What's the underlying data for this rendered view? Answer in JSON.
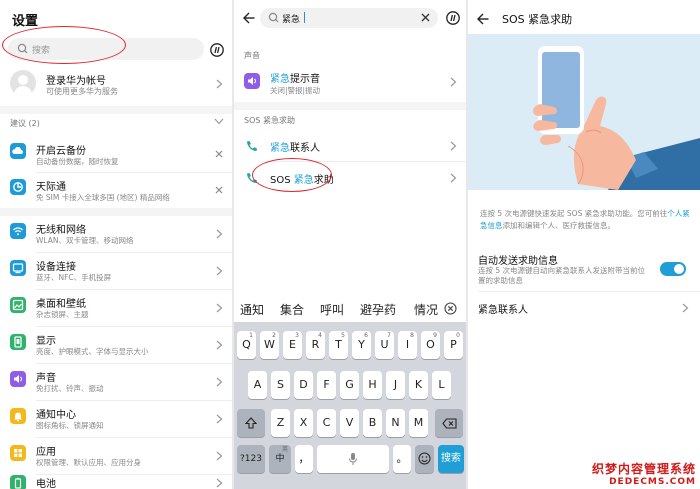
{
  "settings": {
    "title": "设置",
    "search_placeholder": "搜索",
    "account": {
      "title": "登录华为帐号",
      "subtitle": "可使用更多华为服务"
    },
    "suggestions_header": "建议 (2)",
    "suggestions": [
      {
        "title": "开启云备份",
        "subtitle": "自动备份数据，随时恢复",
        "icon": "cloud-backup-icon"
      },
      {
        "title": "天际通",
        "subtitle": "免 SIM 卡接入全球多国 (地区) 精品网络",
        "icon": "skytone-icon"
      }
    ],
    "items": [
      {
        "title": "无线和网络",
        "subtitle": "WLAN、双卡管理、移动网络",
        "icon": "wifi-icon"
      },
      {
        "title": "设备连接",
        "subtitle": "蓝牙、NFC、手机投屏",
        "icon": "device-connect-icon"
      },
      {
        "title": "桌面和壁纸",
        "subtitle": "杂志锁屏、主题",
        "icon": "wallpaper-icon"
      },
      {
        "title": "显示",
        "subtitle": "亮度、护眼模式、字体与显示大小",
        "icon": "display-icon"
      },
      {
        "title": "声音",
        "subtitle": "免打扰、铃声、振动",
        "icon": "sound-icon"
      },
      {
        "title": "通知中心",
        "subtitle": "图标角标、锁屏通知",
        "icon": "notification-icon"
      },
      {
        "title": "应用",
        "subtitle": "权限管理、默认应用、应用分身",
        "icon": "apps-icon"
      },
      {
        "title": "电池",
        "subtitle": "",
        "icon": "battery-icon"
      }
    ]
  },
  "search": {
    "query": "紧急",
    "section_sound": "声音",
    "result_sound": {
      "hl": "紧急",
      "rest": "提示音",
      "subtitle": "关闭|警报|振动"
    },
    "section_sos": "SOS 紧急求助",
    "result_contacts": {
      "hl": "紧急",
      "rest": "联系人"
    },
    "result_sos": {
      "pre": "SOS ",
      "hl": "紧急",
      "rest": "求助"
    },
    "suggestions_bar": [
      "通知",
      "集合",
      "呼叫",
      "避孕药",
      "情况"
    ],
    "keyboard": {
      "row1": [
        "Q",
        "W",
        "E",
        "R",
        "T",
        "Y",
        "U",
        "I",
        "O",
        "P"
      ],
      "row1_sub": [
        "1",
        "2",
        "3",
        "4",
        "5",
        "6",
        "7",
        "8",
        "9",
        "0"
      ],
      "row2": [
        "A",
        "S",
        "D",
        "F",
        "G",
        "H",
        "J",
        "K",
        "L"
      ],
      "row3": [
        "Z",
        "X",
        "C",
        "V",
        "B",
        "N",
        "M"
      ],
      "key_123": "?123",
      "key_lang": "中",
      "key_lang_sub": "英",
      "key_comma": "，",
      "key_period": "。",
      "key_search": "搜索"
    }
  },
  "sos": {
    "title": "SOS 紧急求助",
    "desc_part1": "连按 5 次电源键快速发起 SOS 紧急求助功能。您可前往",
    "desc_link": "个人紧急信息",
    "desc_part2": "添加和编辑个人、医疗救援信息。",
    "auto_send": {
      "title": "自动发送求助信息",
      "subtitle": "连按 5 次电源键自动向紧急联系人发送附带当前位置的求助信息",
      "enabled": true
    },
    "contacts_label": "紧急联系人"
  },
  "watermark": {
    "line1": "织梦内容管理系统",
    "line2": "DEDECMS.COM"
  },
  "colors": {
    "accent": "#1f9fd6",
    "annotation": "#e0272d",
    "illustration_bg": "#dcecf7"
  }
}
